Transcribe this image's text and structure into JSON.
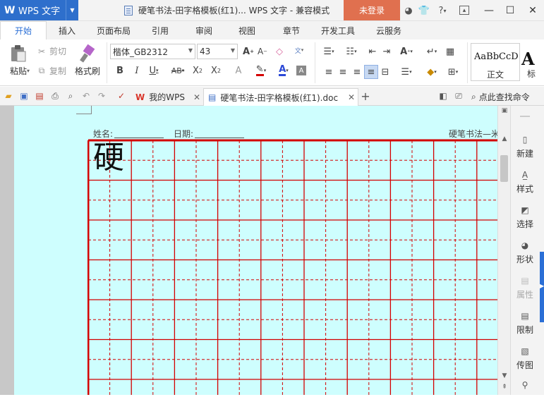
{
  "app": {
    "logo": "W",
    "name": "WPS 文字"
  },
  "window": {
    "title": "硬笔书法-田字格模板(红1)... WPS 文字 - 兼容模式",
    "login": "未登录"
  },
  "titlebar_icons": [
    "skin-icon",
    "shirt-icon",
    "help-icon",
    "restore-icon",
    "minimize-icon",
    "maximize-icon",
    "close-icon"
  ],
  "tabs": [
    {
      "label": "开始",
      "active": true
    },
    {
      "label": "插入"
    },
    {
      "label": "页面布局"
    },
    {
      "label": "引用"
    },
    {
      "label": "审阅"
    },
    {
      "label": "视图"
    },
    {
      "label": "章节"
    },
    {
      "label": "开发工具"
    },
    {
      "label": "云服务"
    }
  ],
  "ribbon": {
    "paste": "粘贴",
    "cut": "剪切",
    "copy": "复制",
    "format_painter": "格式刷",
    "font_name": "楷体_GB2312",
    "font_size": "43",
    "style_normal_preview": "AaBbCcD",
    "style_normal_label": "正文",
    "style_heading_preview": "A",
    "style_heading_label": "标"
  },
  "quickbar": {
    "tab_mywps": "我的WPS",
    "tab_doc": "硬笔书法-田字格模板(红1).doc",
    "search": "点此查找命令"
  },
  "document": {
    "name_label": "姓名:",
    "date_label": "日期:",
    "header_right": "硬笔书法—米",
    "first_char": "硬",
    "grid_color": "#d40000",
    "page_color": "#cefefe"
  },
  "taskpane": [
    {
      "label": "新建",
      "icon": "new-icon"
    },
    {
      "label": "样式",
      "icon": "style-icon"
    },
    {
      "label": "选择",
      "icon": "select-icon"
    },
    {
      "label": "形状",
      "icon": "shape-icon"
    },
    {
      "label": "属性",
      "icon": "property-icon",
      "disabled": true
    },
    {
      "label": "限制",
      "icon": "restrict-icon"
    },
    {
      "label": "传图",
      "icon": "upload-image-icon"
    }
  ]
}
